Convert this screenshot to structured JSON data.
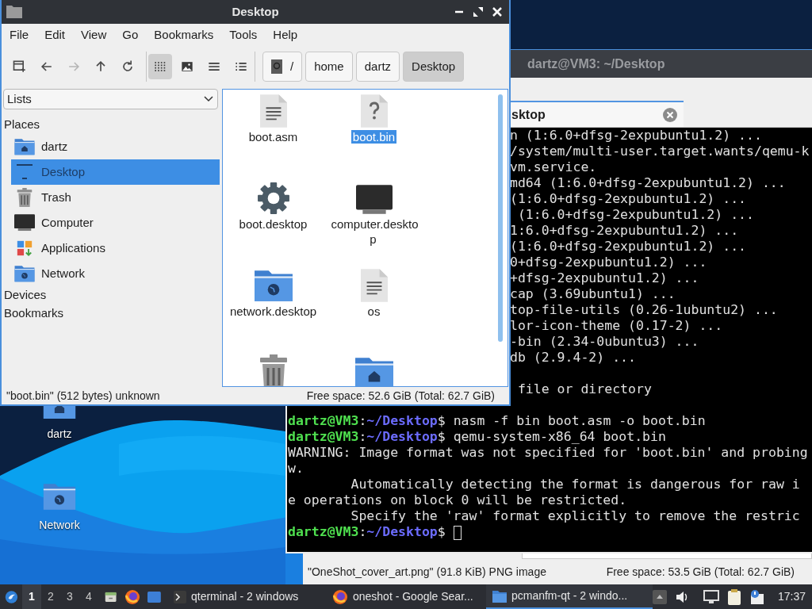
{
  "desktop": {
    "icons": [
      {
        "label": "dartz",
        "kind": "home"
      },
      {
        "label": "Network",
        "kind": "network"
      }
    ]
  },
  "back_window": {
    "status_left": "\"OneShot_cover_art.png\" (91.8 KiB) PNG image",
    "status_right": "Free space: 53.5 GiB (Total: 62.7 GiB)"
  },
  "terminal": {
    "title": "dartz@VM3: ~/Desktop",
    "tab": "sktop",
    "cut_lines": [
      {
        "kind": "output",
        "text": "n (1:6.0+dfsg-2expubuntu1.2) ..."
      },
      {
        "kind": "output",
        "text": "/system/multi-user.target.wants/qemu-k"
      },
      {
        "kind": "output",
        "text": "vm.service."
      },
      {
        "kind": "output",
        "text": "md64 (1:6.0+dfsg-2expubuntu1.2) ..."
      },
      {
        "kind": "output",
        "text": "(1:6.0+dfsg-2expubuntu1.2) ..."
      },
      {
        "kind": "output",
        "text": " (1:6.0+dfsg-2expubuntu1.2) ..."
      },
      {
        "kind": "output",
        "text": "1:6.0+dfsg-2expubuntu1.2) ..."
      },
      {
        "kind": "output",
        "text": "(1:6.0+dfsg-2expubuntu1.2) ..."
      },
      {
        "kind": "output",
        "text": "0+dfsg-2expubuntu1.2) ..."
      },
      {
        "kind": "output",
        "text": "+dfsg-2expubuntu1.2) ..."
      },
      {
        "kind": "output",
        "text": "cap (3.69ubuntu1) ..."
      },
      {
        "kind": "output",
        "text": "top-file-utils (0.26-1ubuntu2) ..."
      },
      {
        "kind": "output",
        "text": "lor-icon-theme (0.17-2) ..."
      },
      {
        "kind": "output",
        "text": "-bin (2.34-0ubuntu3) ..."
      },
      {
        "kind": "output",
        "text": "db (2.9.4-2) ..."
      },
      {
        "kind": "blank"
      },
      {
        "kind": "output",
        "text": " file or directory"
      }
    ],
    "lines": [
      {
        "kind": "blank"
      },
      {
        "kind": "prompt",
        "user": "dartz@VM3",
        "sep": ":",
        "path": "~/Desktop",
        "sign": "$",
        "command": "nasm -f bin boot.asm -o boot.bin"
      },
      {
        "kind": "prompt",
        "user": "dartz@VM3",
        "sep": ":",
        "path": "~/Desktop",
        "sign": "$",
        "command": "qemu-system-x86_64 boot.bin"
      },
      {
        "kind": "output",
        "text": "WARNING: Image format was not specified for 'boot.bin' and probing"
      },
      {
        "kind": "output",
        "text": "w."
      },
      {
        "kind": "output",
        "text": "        Automatically detecting the format is dangerous for raw i"
      },
      {
        "kind": "output",
        "text": "e operations on block 0 will be restricted."
      },
      {
        "kind": "output",
        "text": "        Specify the 'raw' format explicitly to remove the restric"
      },
      {
        "kind": "prompt",
        "user": "dartz@VM3",
        "sep": ":",
        "path": "~/Desktop",
        "sign": "$",
        "cursor": true
      }
    ]
  },
  "file_manager": {
    "title": "Desktop",
    "menu": [
      "File",
      "Edit",
      "View",
      "Go",
      "Bookmarks",
      "Tools",
      "Help"
    ],
    "toolbar": [
      {
        "kind": "new-tab",
        "disabled": false
      },
      {
        "kind": "back",
        "disabled": false
      },
      {
        "kind": "forward",
        "disabled": true
      },
      {
        "kind": "up",
        "disabled": false
      },
      {
        "kind": "reload",
        "disabled": false
      }
    ],
    "view_modes": [
      {
        "kind": "icons",
        "selected": true
      },
      {
        "kind": "thumbnails",
        "selected": false
      },
      {
        "kind": "compact",
        "selected": false
      },
      {
        "kind": "details",
        "selected": false
      }
    ],
    "path": [
      {
        "label": "/",
        "kind": "root",
        "selected": false
      },
      {
        "label": "home",
        "kind": "dir",
        "selected": false
      },
      {
        "label": "dartz",
        "kind": "dir",
        "selected": false
      },
      {
        "label": "Desktop",
        "kind": "dir",
        "selected": true
      }
    ],
    "side_dropdown": "Lists",
    "places_header": "Places",
    "places": [
      {
        "label": "dartz",
        "kind": "home",
        "selected": false
      },
      {
        "label": "Desktop",
        "kind": "desktop",
        "selected": true
      },
      {
        "label": "Trash",
        "kind": "trash",
        "selected": false
      },
      {
        "label": "Computer",
        "kind": "computer",
        "selected": false
      },
      {
        "label": "Applications",
        "kind": "apps",
        "selected": false
      },
      {
        "label": "Network",
        "kind": "network",
        "selected": false
      }
    ],
    "other_headers": [
      "Devices",
      "Bookmarks"
    ],
    "files": [
      {
        "label": "boot.asm",
        "kind": "text",
        "selected": false
      },
      {
        "label": "boot.bin",
        "kind": "unknown",
        "selected": true
      },
      {
        "label": "boot.desktop",
        "kind": "settings",
        "selected": false
      },
      {
        "label": "computer.desktop",
        "kind": "computer",
        "selected": false
      },
      {
        "label": "network.desktop",
        "kind": "network",
        "selected": false
      },
      {
        "label": "os",
        "kind": "text",
        "selected": false
      },
      {
        "kind": "trash"
      },
      {
        "kind": "home"
      }
    ],
    "status_left": "\"boot.bin\" (512 bytes) unknown",
    "status_right": "Free space: 52.6 GiB (Total: 62.7 GiB)"
  },
  "taskbar": {
    "workspaces": [
      {
        "label": "1",
        "selected": true
      },
      {
        "label": "2",
        "selected": false
      },
      {
        "label": "3",
        "selected": false
      },
      {
        "label": "4",
        "selected": false
      }
    ],
    "tasks": [
      {
        "label": "qterminal - 2 windows",
        "kind": "terminal",
        "selected": false
      },
      {
        "label": "oneshot - Google Sear...",
        "kind": "browser",
        "selected": false
      },
      {
        "label": "pcmanfm-qt - 2 windo...",
        "kind": "folder",
        "selected": true
      }
    ],
    "clock": "17:37"
  }
}
